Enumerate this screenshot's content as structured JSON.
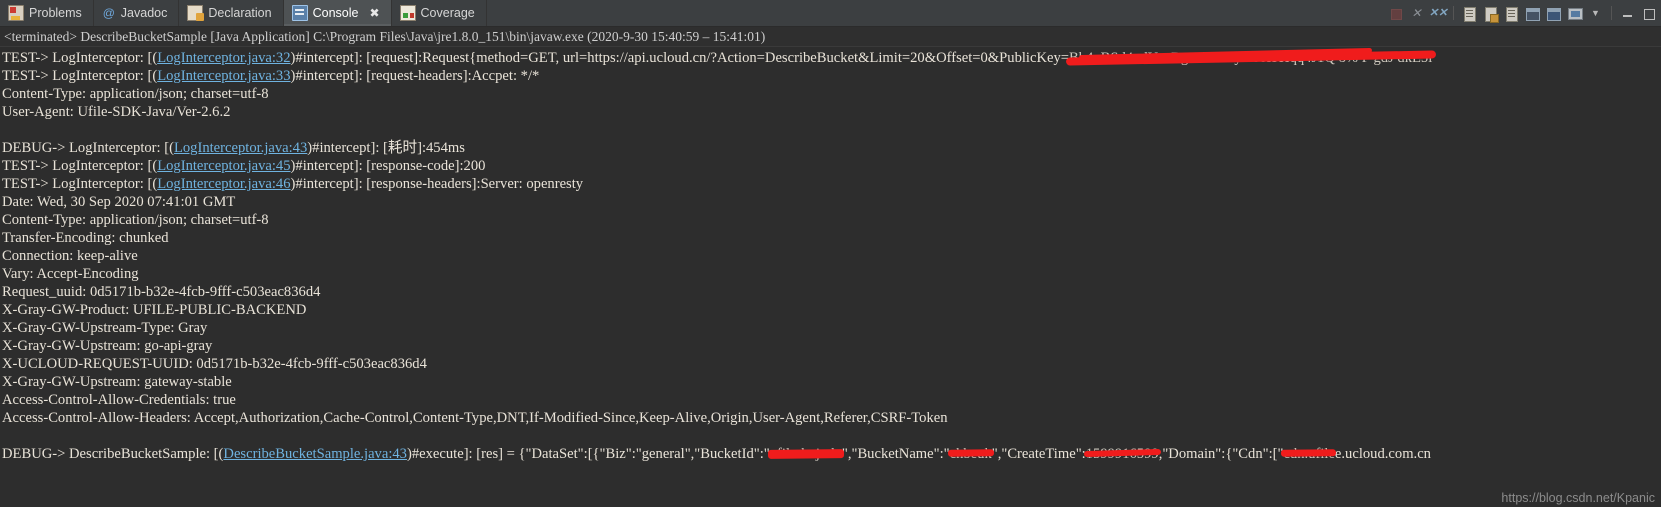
{
  "window": {
    "tabs": [
      {
        "id": "problems",
        "label": "Problems",
        "icon": "problems-icon",
        "active": false,
        "closable": false
      },
      {
        "id": "javadoc",
        "label": "Javadoc",
        "icon": "javadoc-icon",
        "active": false,
        "closable": false
      },
      {
        "id": "declaration",
        "label": "Declaration",
        "icon": "declaration-icon",
        "active": false,
        "closable": false
      },
      {
        "id": "console",
        "label": "Console",
        "icon": "console-icon",
        "active": true,
        "closable": true,
        "close_glyph": "✖"
      },
      {
        "id": "coverage",
        "label": "Coverage",
        "icon": "coverage-icon",
        "active": false,
        "closable": false
      }
    ],
    "toolbar": [
      {
        "id": "terminate",
        "name": "terminate-button",
        "title": "Terminate"
      },
      {
        "id": "remove-launch",
        "name": "remove-launch-button",
        "title": "Remove Launch"
      },
      {
        "id": "remove-all-launches",
        "name": "remove-all-terminated-launches-button",
        "title": "Remove All Terminated Launches"
      },
      {
        "id": "clear-console",
        "name": "clear-console-button",
        "title": "Clear Console"
      },
      {
        "id": "scroll-lock",
        "name": "scroll-lock-button",
        "title": "Scroll Lock"
      },
      {
        "id": "word-wrap",
        "name": "word-wrap-button",
        "title": "Word Wrap"
      },
      {
        "id": "pin-console",
        "name": "pin-console-button",
        "title": "Pin Console"
      },
      {
        "id": "display-selected-console",
        "name": "display-selected-console-button",
        "title": "Display Selected Console"
      },
      {
        "id": "open-console",
        "name": "open-console-button",
        "title": "Open Console"
      },
      {
        "id": "view-menu",
        "name": "view-menu-button",
        "title": "View Menu"
      },
      {
        "id": "minimize",
        "name": "minimize-button",
        "title": "Minimize"
      },
      {
        "id": "maximize",
        "name": "maximize-button",
        "title": "Maximize"
      }
    ]
  },
  "status": {
    "text": "<terminated> DescribeBucketSample [Java Application] C:\\Program Files\\Java\\jre1.8.0_151\\bin\\javaw.exe  (2020-9-30 15:40:59 – 15:41:01)"
  },
  "console": {
    "lines": [
      {
        "type": "log",
        "level": "TEST->",
        "pre": "TEST-> LogInterceptor: [(",
        "link": "LogInterceptor.java:32",
        "post": ")#intercept]: [request]:Request{method=GET, url=https://api.ucloud.cn/?Action=DescribeBucket&Limit=20&Offset=0&PublicKey=",
        "redacted": "Bb4uBSd4odYsnRgn4l0BKyOoolSHqq4J1Q 8%  F gdJ dkE5i",
        "redaction_style": "scribble"
      },
      {
        "type": "log",
        "pre": "TEST-> LogInterceptor: [(",
        "link": "LogInterceptor.java:33",
        "post": ")#intercept]: [request-headers]:Accpet: */*"
      },
      {
        "type": "plain",
        "text": "Content-Type: application/json; charset=utf-8"
      },
      {
        "type": "plain",
        "text": "User-Agent: Ufile-SDK-Java/Ver-2.6.2"
      },
      {
        "type": "blank"
      },
      {
        "type": "log",
        "pre": "DEBUG-> LogInterceptor: [(",
        "link": "LogInterceptor.java:43",
        "post": ")#intercept]: [耗时]:454ms"
      },
      {
        "type": "log",
        "pre": "TEST-> LogInterceptor: [(",
        "link": "LogInterceptor.java:45",
        "post": ")#intercept]: [response-code]:200"
      },
      {
        "type": "log",
        "pre": "TEST-> LogInterceptor: [(",
        "link": "LogInterceptor.java:46",
        "post": ")#intercept]: [response-headers]:Server: openresty"
      },
      {
        "type": "plain",
        "text": "Date: Wed, 30 Sep 2020 07:41:01 GMT"
      },
      {
        "type": "plain",
        "text": "Content-Type: application/json; charset=utf-8"
      },
      {
        "type": "plain",
        "text": "Transfer-Encoding: chunked"
      },
      {
        "type": "plain",
        "text": "Connection: keep-alive"
      },
      {
        "type": "plain",
        "text": "Vary: Accept-Encoding"
      },
      {
        "type": "plain",
        "text": "Request_uuid: 0d5171b-b32e-4fcb-9fff-c503eac836d4"
      },
      {
        "type": "plain",
        "text": "X-Gray-GW-Product: UFILE-PUBLIC-BACKEND"
      },
      {
        "type": "plain",
        "text": "X-Gray-GW-Upstream-Type: Gray"
      },
      {
        "type": "plain",
        "text": "X-Gray-GW-Upstream: go-api-gray"
      },
      {
        "type": "plain",
        "text": "X-UCLOUD-REQUEST-UUID: 0d5171b-b32e-4fcb-9fff-c503eac836d4"
      },
      {
        "type": "plain",
        "text": "X-Gray-GW-Upstream: gateway-stable"
      },
      {
        "type": "plain",
        "text": "Access-Control-Allow-Credentials: true"
      },
      {
        "type": "plain",
        "text": "Access-Control-Allow-Headers: Accept,Authorization,Cache-Control,Content-Type,DNT,If-Modified-Since,Keep-Alive,Origin,User-Agent,Referer,CSRF-Token"
      },
      {
        "type": "blank"
      },
      {
        "type": "result",
        "pre": "DEBUG-> DescribeBucketSample: [(",
        "link": "DescribeBucketSample.java:43",
        "mid": ")#execute]: [res] = {\"DataSet\":[{\"Biz\":\"general\",\"BucketId\":\"",
        "redacted_bucket_id": "ufile-bnjudn",
        "seg2": "\",\"BucketName\":\"",
        "redacted_bucket_name": "chbeuk",
        "seg3": "\",\"CreateTime\":",
        "redacted_create_time": "1599916599",
        "seg4": ",\"Domain\":{\"Cdn\":[\"",
        "redacted_cdn": "cdn.ufile",
        "tail": "e.ucloud.com.cn"
      }
    ]
  },
  "watermark": {
    "text": "https://blog.csdn.net/Kpanic"
  },
  "colors": {
    "tabbar_bg": "#3c3f41",
    "tab_active_bg": "#4e5254",
    "console_bg": "#2d2d2d",
    "text": "#e9e3d8",
    "link": "#6fb3e0",
    "redaction": "#f01c1c",
    "status_text": "#cfcfcf"
  }
}
